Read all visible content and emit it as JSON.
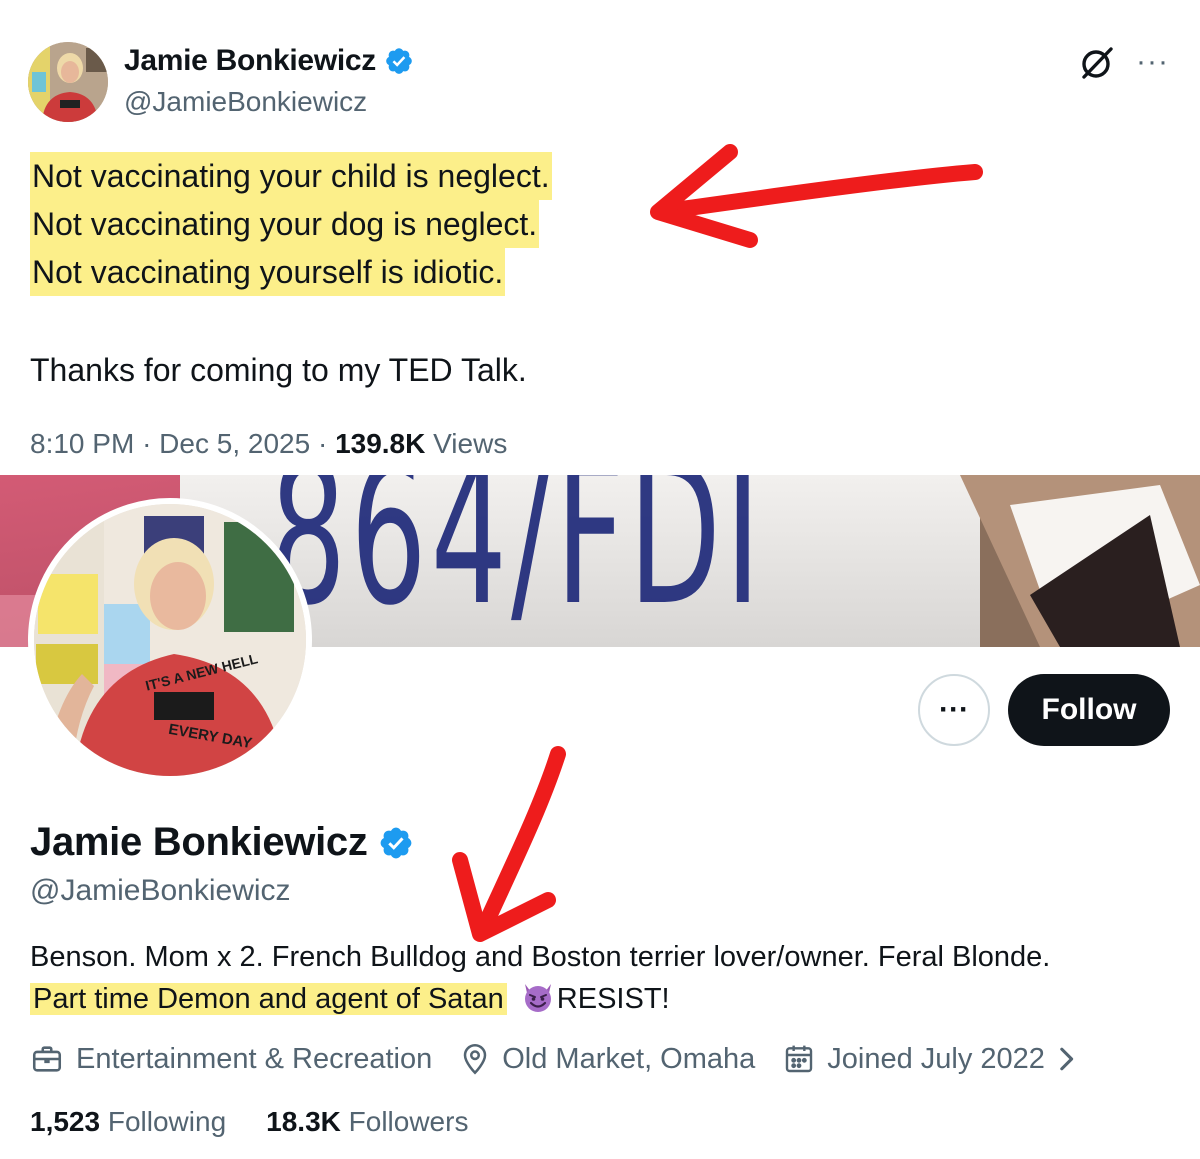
{
  "tweet": {
    "author_name": "Jamie Bonkiewicz",
    "author_handle": "@JamieBonkiewicz",
    "lines": [
      "Not vaccinating your child is neglect.",
      "Not vaccinating your dog is neglect.",
      "Not vaccinating yourself is idiotic."
    ],
    "closing": "Thanks for coming to my TED Talk.",
    "time": "8:10 PM",
    "date": "Dec 5, 2025",
    "views_count": "139.8K",
    "views_label": "Views",
    "separator": "·"
  },
  "banner": {
    "plate_text": "864/FDI"
  },
  "avatar_shirt": {
    "top": "IT'S A NEW HELL",
    "bottom": "EVERY DAY"
  },
  "profile": {
    "name": "Jamie Bonkiewicz",
    "handle": "@JamieBonkiewicz",
    "follow_label": "Follow",
    "more_label": "···",
    "bio_plain": "Benson. Mom x 2. French Bulldog and Boston terrier lover/owner. Feral Blonde.",
    "bio_highlight": "Part time Demon and agent of Satan",
    "bio_end": "RESIST!",
    "category": "Entertainment & Recreation",
    "location": "Old Market, Omaha",
    "joined": "Joined July 2022",
    "following_count": "1,523",
    "following_label": "Following",
    "followers_count": "18.3K",
    "followers_label": "Followers"
  },
  "icons": {
    "verified": "verified-badge-icon",
    "grok": "grok-icon",
    "more": "more-icon",
    "briefcase": "briefcase-icon",
    "location": "location-pin-icon",
    "calendar": "calendar-icon",
    "chevron": "chevron-right-icon",
    "emoji": "smiling-devil-emoji"
  },
  "colors": {
    "highlight": "#fcef8a",
    "verified": "#1d9bf0",
    "annotation_arrow": "#ee1c1c",
    "text_secondary": "#536471",
    "follow_bg": "#0f1419",
    "plate_text": "#1f2a7a"
  }
}
